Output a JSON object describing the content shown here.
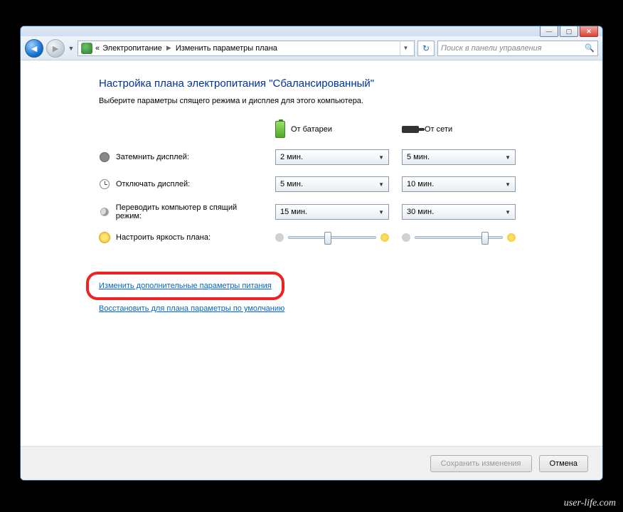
{
  "window": {
    "breadcrumbs": {
      "prefix": "«",
      "part1": "Электропитание",
      "part2": "Изменить параметры плана"
    },
    "search_placeholder": "Поиск в панели управления"
  },
  "page": {
    "heading": "Настройка плана электропитания \"Сбалансированный\"",
    "subheading": "Выберите параметры спящего режима и дисплея для этого компьютера."
  },
  "columns": {
    "battery": "От батареи",
    "ac": "От сети"
  },
  "rows": {
    "dim": {
      "label": "Затемнить дисплей:",
      "battery": "2 мин.",
      "ac": "5 мин."
    },
    "off": {
      "label": "Отключать дисплей:",
      "battery": "5 мин.",
      "ac": "10 мин."
    },
    "sleep": {
      "label": "Переводить компьютер в спящий режим:",
      "battery": "15 мин.",
      "ac": "30 мин."
    },
    "brightness": {
      "label": "Настроить яркость плана:"
    }
  },
  "brightness": {
    "battery_percent": 45,
    "ac_percent": 80
  },
  "links": {
    "advanced": "Изменить дополнительные параметры питания",
    "restore": "Восстановить для плана параметры по умолчанию"
  },
  "buttons": {
    "save": "Сохранить изменения",
    "cancel": "Отмена"
  },
  "watermark": "user-life.com"
}
